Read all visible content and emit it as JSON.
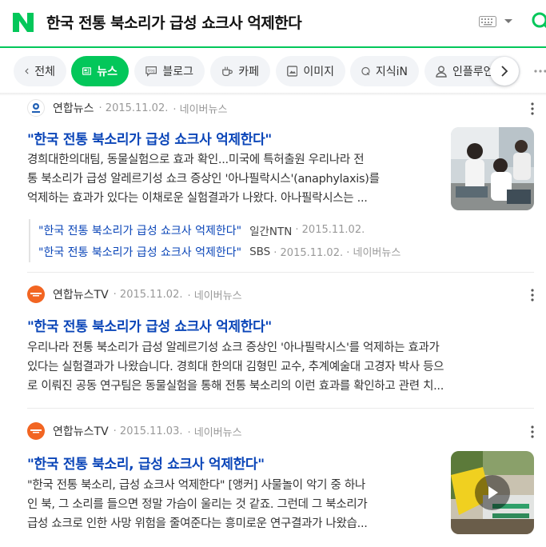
{
  "search": {
    "query": "한국 전통 북소리가 급성 쇼크사 억제한다"
  },
  "tabs": [
    {
      "label": "전체",
      "icon": "chevron-left-icon"
    },
    {
      "label": "뉴스",
      "icon": "news-icon",
      "active": true
    },
    {
      "label": "블로그",
      "icon": "blog-icon"
    },
    {
      "label": "카페",
      "icon": "cafe-icon"
    },
    {
      "label": "이미지",
      "icon": "image-icon"
    },
    {
      "label": "지식iN",
      "icon": "kin-icon"
    },
    {
      "label": "인플루언",
      "icon": "person-icon"
    }
  ],
  "articles": [
    {
      "source": "연합뉴스",
      "date": "· 2015.11.02.",
      "via": "· 네이버뉴스",
      "title": "\"한국 전통 북소리가 급성 쇼크사 억제한다\"",
      "desc_lines": [
        "경희대한의대팀, 동물실험으로 효과 확인...미국에 특허출원 우리나라 전",
        "통 북소리가 급성 알레르기성 쇼크 증상인 '아나필락시스'(anaphylaxis)를",
        "억제하는 효과가 있다는 이채로운 실험결과가 나왔다. 아나필락시스는 ..."
      ],
      "related": [
        {
          "title": "\"한국 전통 북소리가 급성 쇼크사 억제한다\"",
          "source": "일간NTN",
          "meta": "· 2015.11.02."
        },
        {
          "title": "\"한국 전통 북소리가 급성 쇼크사 억제한다\"",
          "source": "SBS",
          "meta": "· 2015.11.02. · 네이버뉴스"
        }
      ]
    },
    {
      "source": "연합뉴스TV",
      "date": "· 2015.11.02.",
      "via": "· 네이버뉴스",
      "title": "\"한국 전통 북소리가 급성 쇼크사 억제한다\"",
      "desc_lines": [
        "우리나라 전통 북소리가 급성 알레르기성 쇼크 증상인 '아나필락시스'를 억제하는 효과가",
        "있다는 실험결과가 나왔습니다. 경희대 한의대 김형민 교수, 추계예술대 고경자 박사 등으",
        "로 이뤄진 공동 연구팀은 동물실험을 통해 전통 북소리의 이런 효과를 확인하고 관련 치..."
      ]
    },
    {
      "source": "연합뉴스TV",
      "date": "· 2015.11.03.",
      "via": "· 네이버뉴스",
      "title": "\"한국 전통 북소리, 급성 쇼크사 억제한다\"",
      "desc_lines": [
        "\"한국 전통 북소리, 급성 쇼크사 억제한다\" [앵커] 사물놀이 악기 중 하나",
        "인 북, 그 소리를 들으면 정말 가슴이 울리는 것 같죠. 그런데 그 북소리가",
        "급성 쇼크로 인한 사망 위험을 줄여준다는 흥미로운 연구결과가 나왔습..."
      ]
    }
  ],
  "colors": {
    "brand": "#03c75a",
    "link": "#0a45b8"
  }
}
